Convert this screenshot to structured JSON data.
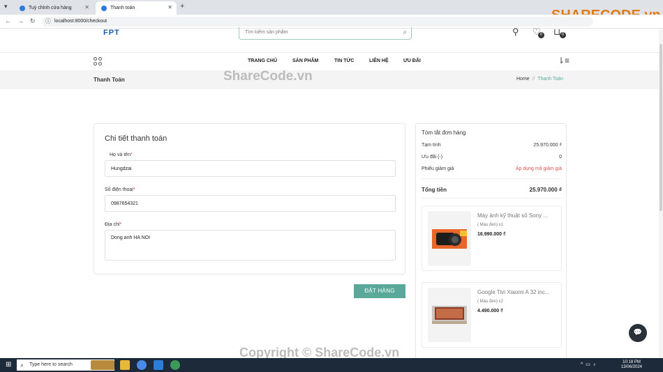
{
  "browser": {
    "tabs": [
      {
        "title": "Tuỳ chỉnh cửa hàng"
      },
      {
        "title": "Thanh toán"
      }
    ],
    "url": "localhost:8000/checkout"
  },
  "watermark": {
    "top": "ShareCode.vn",
    "bottom": "Copyright © ShareCode.vn",
    "logo_main": "SHARE",
    "logo_accent": "CODE.vn"
  },
  "header": {
    "logo": "FPT",
    "search_placeholder": "Tìm kiếm sản phẩm",
    "wishlist_count": "0",
    "cart_count": "0",
    "menu": [
      "TRANG CHỦ",
      "SẢN PHẨM",
      "TIN TỨC",
      "LIÊN HỆ",
      "ƯU ĐÃI"
    ]
  },
  "breadcrumb": {
    "title": "Thanh Toán",
    "home": "Home",
    "sep": "//",
    "current": "Thanh Toán"
  },
  "billing": {
    "heading": "Chi tiết thanh toán",
    "name_label": "Họ và tên",
    "name_value": "Hungdzai",
    "phone_label": "Số điện thoại",
    "phone_value": "0987654321",
    "address_label": "Địa chỉ",
    "address_value": "Dong anh HA NOI",
    "required_mark": "*",
    "submit": "ĐẶT HÀNG"
  },
  "summary": {
    "heading": "Tóm tắt đơn hàng",
    "subtotal_label": "Tạm tính",
    "subtotal_value": "25.970.000 ₫",
    "discount_label": "Ưu đãi (-)",
    "discount_value": "0",
    "coupon_label": "Phiếu giảm giá",
    "coupon_value": "Áp dụng mã giảm giá",
    "total_label": "Tổng tiền",
    "total_value": "25.970.000 ₫",
    "items": [
      {
        "name": "Máy ảnh kỹ thuật số Sony ...",
        "variant": "( Màu đen) x1",
        "price": "16.990.000 ₫"
      },
      {
        "name": "Google Tivi Xiaomi A 32 inc...",
        "variant": "( Màu đen) x2",
        "price": "4.490.000 ₫"
      }
    ]
  },
  "taskbar": {
    "search": "Type here to search",
    "time": "10:18 PM",
    "date": "13/06/2024"
  }
}
